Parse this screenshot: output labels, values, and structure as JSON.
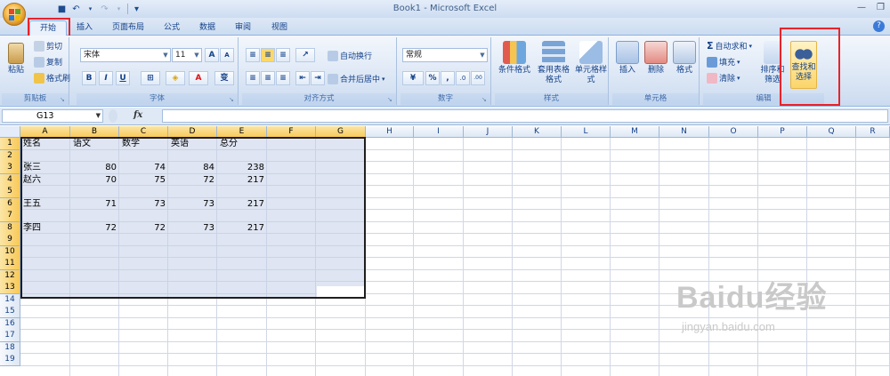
{
  "window": {
    "title": "Book1 - Microsoft Excel",
    "min_label": "—",
    "restore_label": "❐",
    "close_label": "✕"
  },
  "qat": {
    "save_glyph": "■",
    "undo_glyph": "↶",
    "redo_glyph": "↷",
    "customize_glyph": "▾"
  },
  "tabs": [
    "开始",
    "插入",
    "页面布局",
    "公式",
    "数据",
    "审阅",
    "视图"
  ],
  "help_glyph": "?",
  "ribbon": {
    "clipboard": {
      "label": "剪贴板",
      "paste": "粘贴",
      "cut": "剪切",
      "copy": "复制",
      "format_painter": "格式刷"
    },
    "font": {
      "label": "字体",
      "font_name": "宋体",
      "font_size": "11",
      "bold": "B",
      "italic": "I",
      "underline": "U",
      "grow": "A",
      "shrink": "A",
      "font_color": "A",
      "phonetic": "变"
    },
    "alignment": {
      "label": "对齐方式",
      "wrap": "自动换行",
      "merge": "合并后居中"
    },
    "number": {
      "label": "数字",
      "format": "常规",
      "percent": "%",
      "comma": ",",
      "inc": ".0",
      "dec": ".00"
    },
    "styles": {
      "label": "样式",
      "conditional": "条件格式",
      "table": "套用表格格式",
      "cell": "单元格样式"
    },
    "cells": {
      "label": "单元格",
      "insert": "插入",
      "delete": "删除",
      "format": "格式"
    },
    "editing": {
      "label": "编辑",
      "autosum": "自动求和",
      "fill": "填充",
      "clear": "清除",
      "sort": "排序和筛选",
      "find": "查找和选择"
    }
  },
  "formula_bar": {
    "name_box": "G13",
    "fx": "fx",
    "formula": ""
  },
  "sheet": {
    "columns": [
      "A",
      "B",
      "C",
      "D",
      "E",
      "F",
      "G",
      "H",
      "I",
      "J",
      "K",
      "L",
      "M",
      "N",
      "O",
      "P",
      "Q",
      "R"
    ],
    "rows": [
      "1",
      "2",
      "3",
      "4",
      "5",
      "6",
      "7",
      "8",
      "9",
      "10",
      "11",
      "12",
      "13",
      "14",
      "15",
      "16",
      "17",
      "18",
      "19"
    ],
    "headers": [
      "姓名",
      "语文",
      "数学",
      "英语",
      "总分"
    ],
    "data": [
      {
        "row": "3",
        "name": "张三",
        "chinese": "80",
        "math": "74",
        "english": "84",
        "total": "238"
      },
      {
        "row": "4",
        "name": "赵六",
        "chinese": "70",
        "math": "75",
        "english": "72",
        "total": "217"
      },
      {
        "row": "6",
        "name": "王五",
        "chinese": "71",
        "math": "73",
        "english": "73",
        "total": "217"
      },
      {
        "row": "8",
        "name": "李四",
        "chinese": "72",
        "math": "72",
        "english": "73",
        "total": "217"
      }
    ]
  },
  "watermark": {
    "brand": "Baidu经验",
    "url": "jingyan.baidu.com"
  }
}
